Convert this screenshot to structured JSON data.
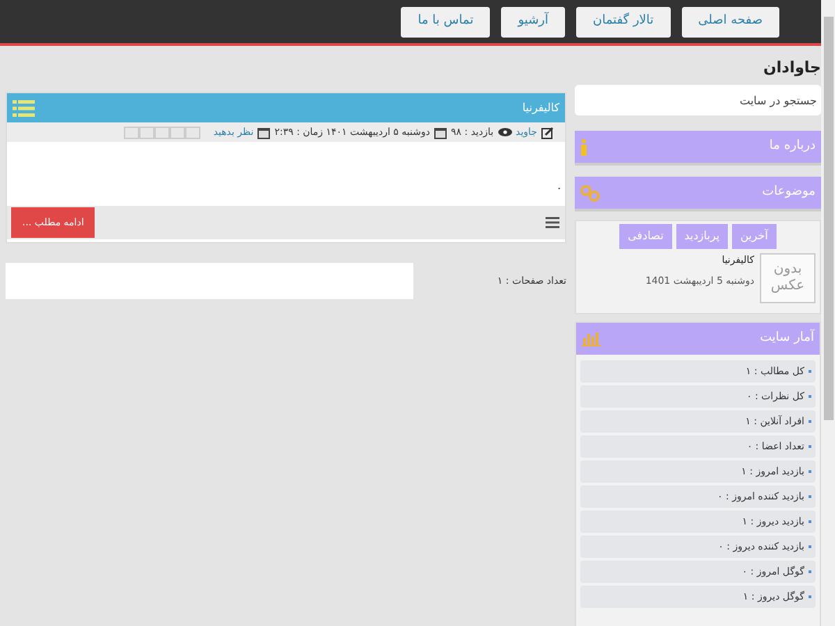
{
  "nav": [
    {
      "label": "صفحه اصلی"
    },
    {
      "label": "تالار گفتمان"
    },
    {
      "label": "آرشیو"
    },
    {
      "label": "تماس با ما"
    }
  ],
  "site_title": "جاوادان",
  "post": {
    "title": "کالیفرنیا",
    "author": "جاوید",
    "views": "بازدید : ۹۸",
    "date": "دوشنبه ۵ اردیبهشت ۱۴۰۱ زمان : ۲:۳۹",
    "comment_link": "نظر بدهید",
    "stars": 0,
    "body": ".",
    "more_button": "ادامه مطلب ..."
  },
  "pagination": {
    "label": "تعداد صفحات : ۱"
  },
  "sidebar": {
    "search": {
      "placeholder": "جستجو در سایت"
    },
    "about": {
      "title": "درباره ما"
    },
    "topics": {
      "title": "موضوعات"
    },
    "posts_box": {
      "tabs": [
        {
          "label": "آخرین"
        },
        {
          "label": "پربازدید"
        },
        {
          "label": "تصادفی"
        }
      ],
      "item": {
        "image_text": "بدون عکس",
        "title": "کالیفرنیا",
        "date": "دوشنبه 5 اردیبهشت 1401"
      }
    },
    "stats": {
      "title": "آمار سایت",
      "rows": [
        "کل مطالب : ۱",
        "کل نظرات : ۰",
        "افراد آنلاین : ۱",
        "تعداد اعضا : ۰",
        "بازدید امروز : ۱",
        "بازدید کننده امروز : ۰",
        "بازدید دیروز : ۱",
        "بازدید کننده دیروز : ۰",
        "گوگل امروز : ۰",
        "گوگل دیروز : ۱"
      ]
    }
  }
}
